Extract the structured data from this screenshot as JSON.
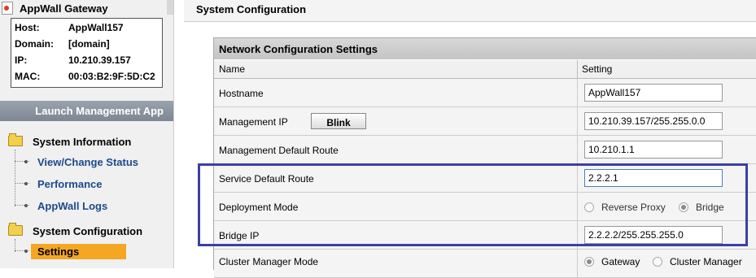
{
  "gateway": {
    "title": "AppWall Gateway",
    "host_label": "Host:",
    "host": "AppWall157",
    "domain_label": "Domain:",
    "domain": "[domain]",
    "ip_label": "IP:",
    "ip": "10.210.39.157",
    "mac_label": "MAC:",
    "mac": "00:03:B2:9F:5D:C2"
  },
  "sidebar": {
    "launch_label": "Launch Management App",
    "system_information": {
      "label": "System Information",
      "items": [
        "View/Change Status",
        "Performance",
        "AppWall Logs"
      ]
    },
    "system_configuration": {
      "label": "System Configuration",
      "items": [
        "Settings"
      ],
      "selected": "Settings"
    }
  },
  "main": {
    "title": "System Configuration",
    "panel_title": "Network Configuration Settings",
    "columns": {
      "name": "Name",
      "setting": "Setting"
    },
    "rows": {
      "hostname": {
        "label": "Hostname",
        "value": "AppWall157"
      },
      "management_ip": {
        "label": "Management IP",
        "button": "Blink",
        "value": "10.210.39.157/255.255.0.0"
      },
      "management_default_route": {
        "label": "Management Default Route",
        "value": "10.210.1.1"
      },
      "service_default_route": {
        "label": "Service Default Route",
        "value": "2.2.2.1"
      },
      "deployment_mode": {
        "label": "Deployment Mode",
        "options": [
          "Reverse Proxy",
          "Bridge"
        ],
        "selected": "Bridge"
      },
      "bridge_ip": {
        "label": "Bridge IP",
        "value": "2.2.2.2/255.255.255.0"
      },
      "cluster_manager_mode": {
        "label": "Cluster Manager Mode",
        "options": [
          "Gateway",
          "Cluster Manager"
        ],
        "selected": "Gateway"
      }
    }
  },
  "colors": {
    "highlight_box": "#3b3fa8",
    "selected_item": "#f5a623",
    "link": "#1b4a8c"
  }
}
